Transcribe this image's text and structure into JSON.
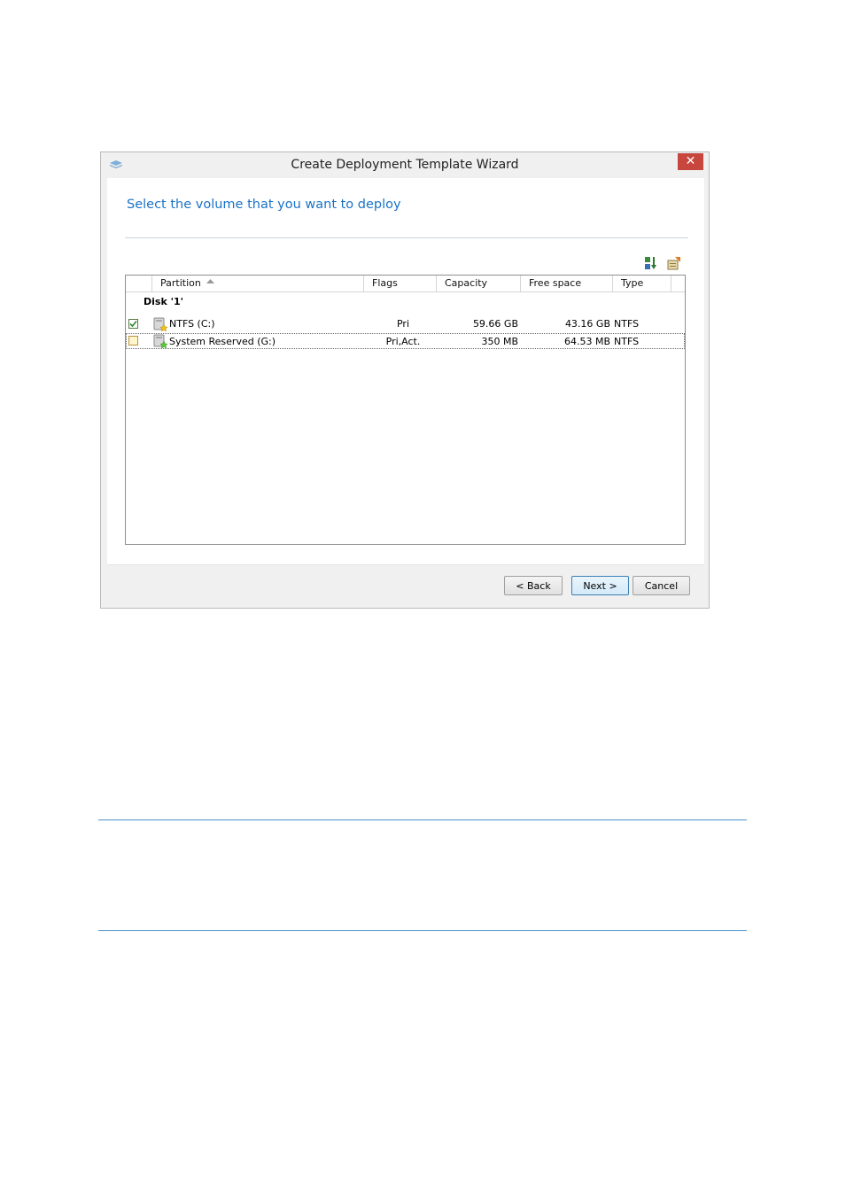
{
  "window": {
    "title": "Create Deployment Template Wizard",
    "close_label": "✕"
  },
  "page": {
    "heading": "Select the volume that you want to deploy"
  },
  "toolbar": {
    "icons": [
      "sort-icon",
      "properties-icon"
    ]
  },
  "grid": {
    "columns": [
      "Partition",
      "Flags",
      "Capacity",
      "Free space",
      "Type"
    ],
    "sorted_column": "Partition",
    "groups": [
      {
        "label": "Disk '1'",
        "rows": [
          {
            "checked": true,
            "name": "NTFS (C:)",
            "flags": "Pri",
            "capacity": "59.66 GB",
            "free": "43.16 GB",
            "type": "NTFS"
          },
          {
            "checked": false,
            "name": "System Reserved (G:)",
            "flags": "Pri,Act.",
            "capacity": "350 MB",
            "free": "64.53 MB",
            "type": "NTFS"
          }
        ]
      }
    ]
  },
  "buttons": {
    "back": "< Back",
    "next": "Next >",
    "cancel": "Cancel"
  },
  "colors": {
    "accent": "#1a73c7",
    "close": "#c7463d"
  }
}
